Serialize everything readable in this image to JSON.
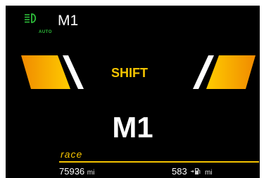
{
  "headlight": {
    "icon": "auto-headlight-icon",
    "auto_label": "AUTO",
    "color": "#2dbd3a"
  },
  "gear_indicator": {
    "small": "M1",
    "large": "M1"
  },
  "shift": {
    "label": "SHIFT",
    "color": "#f5c400",
    "left_icon": "shift-arrow-left-icon",
    "right_icon": "shift-arrow-right-icon"
  },
  "drive_mode": {
    "label": "race",
    "color": "#f5c400"
  },
  "odometer": {
    "value": "75936",
    "unit": "mi"
  },
  "fuel_range": {
    "value": "583",
    "icon": "fuel-pump-icon",
    "unit": "mi"
  }
}
